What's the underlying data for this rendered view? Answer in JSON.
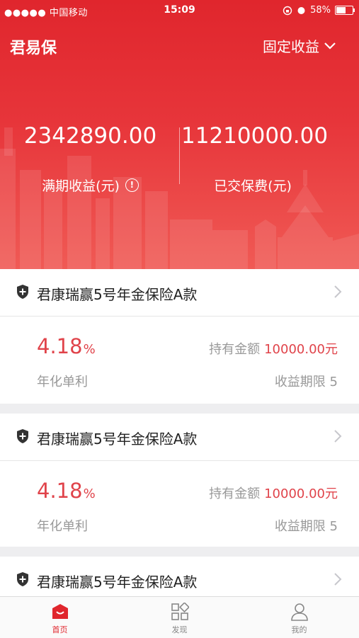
{
  "status_bar": {
    "carrier": "●●●●● 中国移动",
    "time": "15:09",
    "battery": "58%"
  },
  "header": {
    "title": "君易保",
    "filter_label": "固定收益",
    "stats": [
      {
        "value": "2342890.00",
        "label": "满期收益(元)"
      },
      {
        "value": "11210000.00",
        "label": "已交保费(元)"
      }
    ]
  },
  "products": [
    {
      "name": "君康瑞赢5号年金保险A款",
      "rate": "4.18",
      "rate_unit": "%",
      "rate_label": "年化单利",
      "holding_label": "持有金额",
      "holding_amount": "10000.00元",
      "term_label": "收益期限 5"
    },
    {
      "name": "君康瑞赢5号年金保险A款",
      "rate": "4.18",
      "rate_unit": "%",
      "rate_label": "年化单利",
      "holding_label": "持有金额",
      "holding_amount": "10000.00元",
      "term_label": "收益期限 5"
    },
    {
      "name": "君康瑞赢5号年金保险A款"
    }
  ],
  "tabs": [
    {
      "label": "首页",
      "icon": "home-icon",
      "active": true
    },
    {
      "label": "发现",
      "icon": "grid-icon",
      "active": false
    },
    {
      "label": "我的",
      "icon": "user-icon",
      "active": false
    }
  ],
  "colors": {
    "brand_red": "#e0262d",
    "accent_red": "#e0434a",
    "muted_text": "#999999",
    "tab_inactive": "#888888"
  }
}
